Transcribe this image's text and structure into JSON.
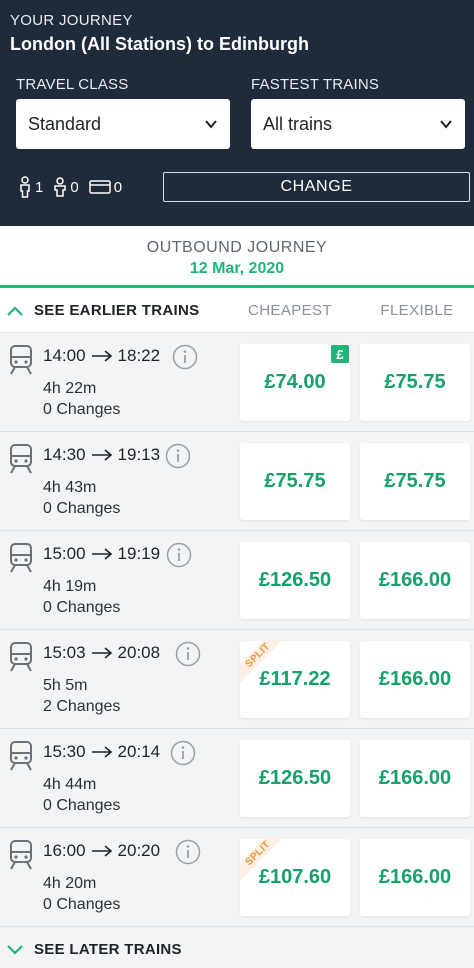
{
  "header": {
    "journey_label": "YOUR JOURNEY",
    "route": "London (All Stations) to Edinburgh",
    "travel_class_label": "TRAVEL CLASS",
    "travel_class_value": "Standard",
    "fastest_label": "FASTEST TRAINS",
    "fastest_value": "All trains",
    "adults": "1",
    "children": "0",
    "railcards": "0",
    "change_label": "CHANGE"
  },
  "outbound": {
    "title": "OUTBOUND JOURNEY",
    "date": "12 Mar, 2020"
  },
  "columns": {
    "earlier": "SEE EARLIER TRAINS",
    "cheapest": "CHEAPEST",
    "flexible": "FLEXIBLE"
  },
  "trains": [
    {
      "depart": "14:00",
      "arrive": "18:22",
      "duration": "4h 22m",
      "changes": "0 Changes",
      "cheapest": "£74.00",
      "flexible": "£75.75",
      "badge": "£",
      "split": ""
    },
    {
      "depart": "14:30",
      "arrive": "19:13",
      "duration": "4h 43m",
      "changes": "0 Changes",
      "cheapest": "£75.75",
      "flexible": "£75.75",
      "badge": "",
      "split": ""
    },
    {
      "depart": "15:00",
      "arrive": "19:19",
      "duration": "4h 19m",
      "changes": "0 Changes",
      "cheapest": "£126.50",
      "flexible": "£166.00",
      "badge": "",
      "split": ""
    },
    {
      "depart": "15:03",
      "arrive": "20:08",
      "duration": "5h 5m",
      "changes": "2 Changes",
      "cheapest": "£117.22",
      "flexible": "£166.00",
      "badge": "",
      "split": "SPLIT"
    },
    {
      "depart": "15:30",
      "arrive": "20:14",
      "duration": "4h 44m",
      "changes": "0 Changes",
      "cheapest": "£126.50",
      "flexible": "£166.00",
      "badge": "",
      "split": ""
    },
    {
      "depart": "16:00",
      "arrive": "20:20",
      "duration": "4h 20m",
      "changes": "0 Changes",
      "cheapest": "£107.60",
      "flexible": "£166.00",
      "badge": "",
      "split": "SPLIT"
    }
  ],
  "footer": {
    "later": "SEE LATER TRAINS"
  },
  "colors": {
    "header_bg": "#1f2a3a",
    "accent_green": "#1fb579",
    "price_green": "#16a06a",
    "split_orange": "#e8943a"
  },
  "icons": [
    "person-icon",
    "child-icon",
    "railcard-icon",
    "chevron-down-icon",
    "chevron-up-icon",
    "train-icon",
    "info-icon",
    "arrow-right-icon"
  ]
}
